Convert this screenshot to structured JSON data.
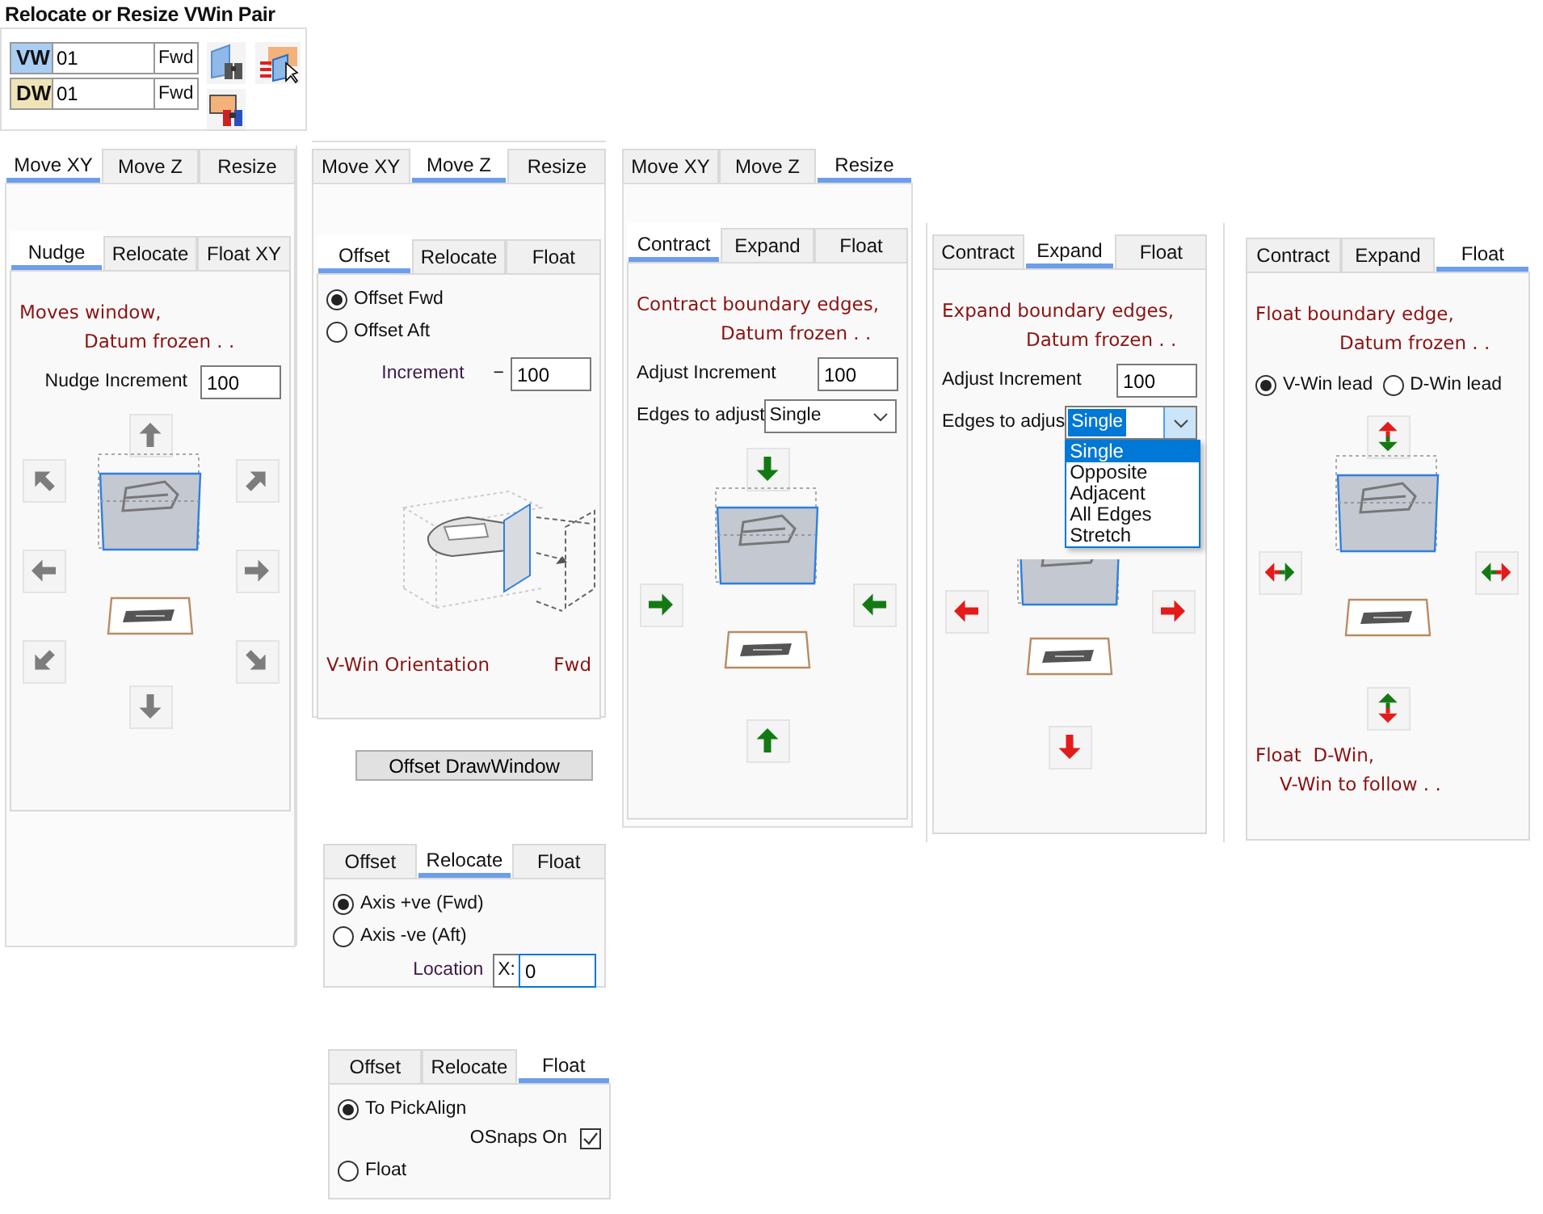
{
  "header": {
    "title": "Relocate or Resize VWin Pair",
    "rows": [
      {
        "tag": "VW",
        "color": "#a9cdf3",
        "value": "01",
        "unit": "Fwd"
      },
      {
        "tag": "DW",
        "color": "#efe4b8",
        "value": "01",
        "unit": "Fwd"
      }
    ]
  },
  "panels": [
    {
      "outer_tabs": [
        {
          "label": "Move XY",
          "selected": true
        },
        {
          "label": "Move Z",
          "selected": false
        },
        {
          "label": "Resize",
          "selected": false
        }
      ],
      "inner_tabs": [
        {
          "label": "Nudge",
          "selected": true
        },
        {
          "label": "Relocate",
          "selected": false
        },
        {
          "label": "Float XY",
          "selected": false
        }
      ],
      "body": [
        {
          "kind": "note",
          "lines": [
            "Moves window,",
            "Datum frozen . ."
          ]
        },
        {
          "kind": "field",
          "label": "Nudge Increment",
          "value": "100"
        },
        {
          "kind": "nudge-pad"
        }
      ]
    },
    {
      "outer_tabs": [
        {
          "label": "Move XY",
          "selected": false
        },
        {
          "label": "Move Z",
          "selected": true
        },
        {
          "label": "Resize",
          "selected": false
        }
      ],
      "inner_tabs": [
        {
          "label": "Offset",
          "selected": true
        },
        {
          "label": "Relocate",
          "selected": false
        },
        {
          "label": "Float",
          "selected": false
        }
      ],
      "body": [
        {
          "kind": "radios",
          "items": [
            {
              "label": "Offset Fwd",
              "checked": true
            },
            {
              "label": "Offset Aft",
              "checked": false
            }
          ]
        },
        {
          "kind": "field",
          "label": "Increment",
          "sign": "−",
          "value": "100"
        },
        {
          "kind": "drawing"
        },
        {
          "kind": "orientation",
          "label": "V-Win Orientation",
          "value": "Fwd"
        }
      ],
      "button": "Offset DrawWindow"
    },
    {
      "inner_tabs": [
        {
          "label": "Offset",
          "selected": false
        },
        {
          "label": "Relocate",
          "selected": true
        },
        {
          "label": "Float",
          "selected": false
        }
      ],
      "body": [
        {
          "kind": "radios",
          "items": [
            {
              "label": "Axis +ve (Fwd)",
              "checked": true
            },
            {
              "label": "Axis -ve (Aft)",
              "checked": false
            }
          ]
        },
        {
          "kind": "location",
          "label": "Location",
          "prefix": "X:",
          "value": "0",
          "focused": true
        }
      ]
    },
    {
      "inner_tabs": [
        {
          "label": "Offset",
          "selected": false
        },
        {
          "label": "Relocate",
          "selected": false
        },
        {
          "label": "Float",
          "selected": true
        }
      ],
      "body": [
        {
          "kind": "radios",
          "items": [
            {
              "label": "To PickAlign",
              "checked": true
            }
          ]
        },
        {
          "kind": "checkbox",
          "label": "OSnaps On",
          "checked": true
        },
        {
          "kind": "radios",
          "items": [
            {
              "label": "Float",
              "checked": false
            }
          ]
        }
      ]
    },
    {
      "outer_tabs": [
        {
          "label": "Move XY",
          "selected": false
        },
        {
          "label": "Move Z",
          "selected": false
        },
        {
          "label": "Resize",
          "selected": true
        }
      ],
      "inner_tabs": [
        {
          "label": "Contract",
          "selected": true
        },
        {
          "label": "Expand",
          "selected": false
        },
        {
          "label": "Float",
          "selected": false
        }
      ],
      "body": [
        {
          "kind": "note",
          "lines": [
            "Contract boundary edges,",
            "Datum frozen . ."
          ]
        },
        {
          "kind": "field",
          "label": "Adjust Increment",
          "value": "100"
        },
        {
          "kind": "combo",
          "label": "Edges to adjust",
          "value": "Single",
          "open": false
        },
        {
          "kind": "contract-pad"
        }
      ]
    },
    {
      "inner_tabs": [
        {
          "label": "Contract",
          "selected": false
        },
        {
          "label": "Expand",
          "selected": true
        },
        {
          "label": "Float",
          "selected": false
        }
      ],
      "body": [
        {
          "kind": "note",
          "lines": [
            "Expand boundary edges,",
            "Datum frozen . ."
          ]
        },
        {
          "kind": "field",
          "label": "Adjust Increment",
          "value": "100"
        },
        {
          "kind": "combo",
          "label": "Edges to adjus",
          "value": "Single",
          "open": true,
          "options": [
            {
              "label": "Single",
              "selected": true
            },
            {
              "label": "Opposite",
              "selected": false
            },
            {
              "label": "Adjacent",
              "selected": false
            },
            {
              "label": "All Edges",
              "selected": false
            },
            {
              "label": "Stretch",
              "selected": false
            }
          ]
        },
        {
          "kind": "expand-pad"
        }
      ]
    },
    {
      "inner_tabs": [
        {
          "label": "Contract",
          "selected": false
        },
        {
          "label": "Expand",
          "selected": false
        },
        {
          "label": "Float",
          "selected": true
        }
      ],
      "body": [
        {
          "kind": "note",
          "lines": [
            "Float boundary edge,",
            "Datum frozen . ."
          ]
        },
        {
          "kind": "radio-row",
          "items": [
            {
              "label": "V-Win lead",
              "checked": true
            },
            {
              "label": "D-Win lead",
              "checked": false
            }
          ]
        },
        {
          "kind": "float-pad"
        },
        {
          "kind": "note",
          "lines": [
            "Float  D-Win,",
            "V-Win to follow . ."
          ]
        }
      ]
    }
  ]
}
